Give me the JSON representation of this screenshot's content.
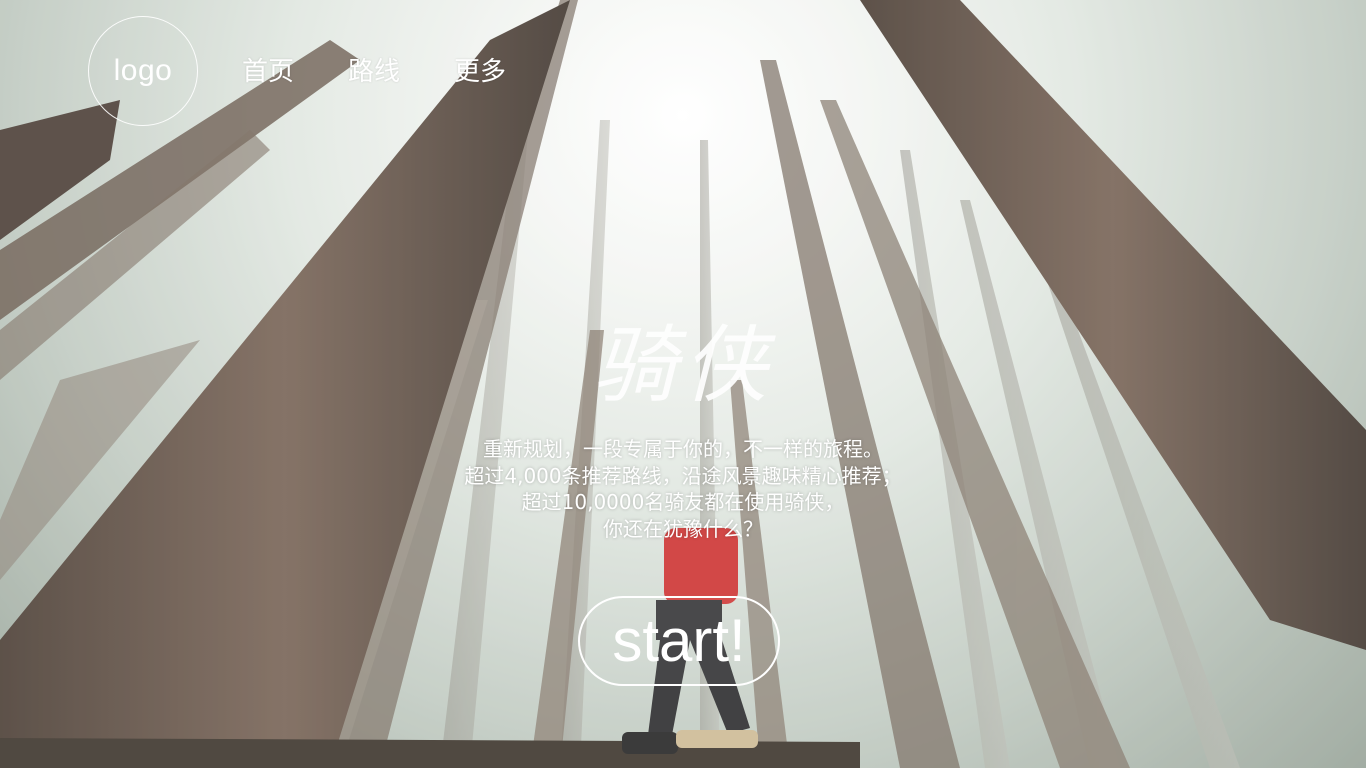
{
  "header": {
    "logo_text": "logo",
    "nav": [
      {
        "label": "首页"
      },
      {
        "label": "路线"
      },
      {
        "label": "更多"
      }
    ]
  },
  "hero": {
    "title": "骑侠",
    "slogan_lines": [
      "重新规划，一段专属于你的，不一样的旅程。",
      "超过4,000条推荐路线，沿途风景趣味精心推荐；",
      "超过10,0000名骑友都在使用骑侠，",
      "你还在犹豫什么？"
    ],
    "start_label": "start!"
  },
  "colors": {
    "text": "#ffffff",
    "jacket_accent": "#c8201f"
  }
}
